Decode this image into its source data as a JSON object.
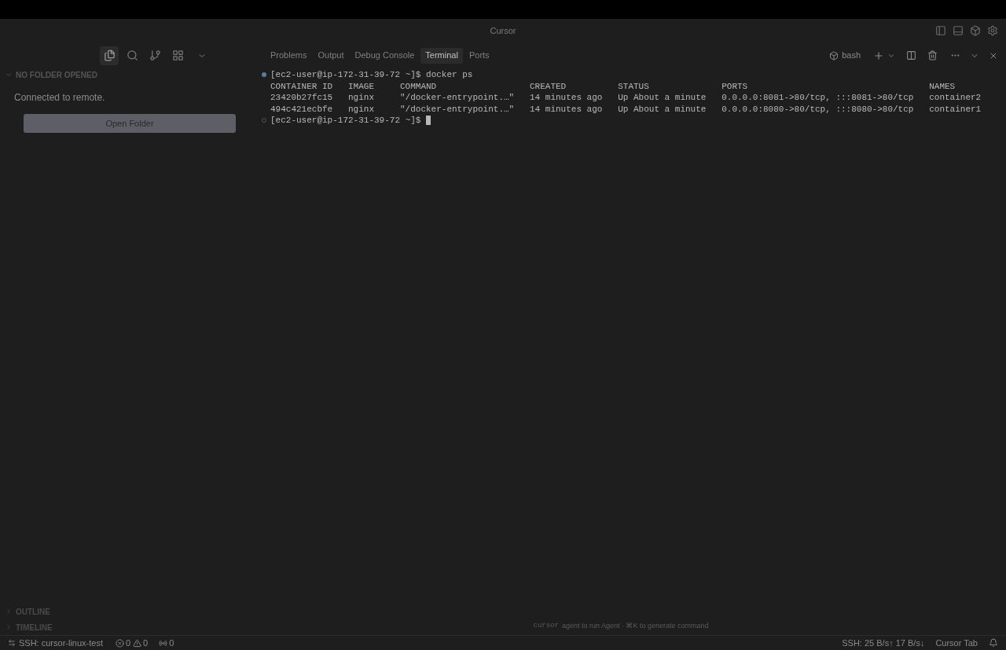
{
  "window": {
    "title": "Cursor"
  },
  "activity_tabs": [
    {
      "kind": "files",
      "selected": true
    },
    {
      "kind": "search",
      "selected": false
    },
    {
      "kind": "source-control",
      "selected": false
    },
    {
      "kind": "extensions",
      "selected": false
    }
  ],
  "sidebar": {
    "section": "NO FOLDER OPENED",
    "expanded": true,
    "message": "Connected to remote.",
    "button": "Open Folder",
    "collapsed_sections": [
      {
        "label": "OUTLINE",
        "expanded": false
      },
      {
        "label": "TIMELINE",
        "expanded": false
      }
    ]
  },
  "panel_tabs": [
    {
      "label": "Problems",
      "selected": false
    },
    {
      "label": "Output",
      "selected": false
    },
    {
      "label": "Debug Console",
      "selected": false
    },
    {
      "label": "Terminal",
      "selected": true
    },
    {
      "label": "Ports",
      "selected": false
    }
  ],
  "terminal_profile": "bash",
  "terminal": {
    "command_line": {
      "prompt": "[ec2-user@ip-172-31-39-72 ~]$",
      "command": "docker ps"
    },
    "table": {
      "columns": [
        "CONTAINER ID",
        "IMAGE",
        "COMMAND",
        "CREATED",
        "STATUS",
        "PORTS",
        "NAMES"
      ],
      "rows": [
        [
          "23420b27fc15",
          "nginx",
          "\"/docker-entrypoint.…\"",
          "14 minutes ago",
          "Up About a minute",
          "0.0.0.0:8081->80/tcp, :::8081->80/tcp",
          "container2"
        ],
        [
          "494c421ecbfe",
          "nginx",
          "\"/docker-entrypoint.…\"",
          "14 minutes ago",
          "Up About a minute",
          "0.0.0.0:8080->80/tcp, :::8080->80/tcp",
          "container1"
        ]
      ]
    },
    "current_prompt": "[ec2-user@ip-172-31-39-72 ~]$"
  },
  "hint": {
    "command": "cursor",
    "text": "agent to run Agent · ⌘K to generate command"
  },
  "status_bar": {
    "remote": "SSH: cursor-linux-test",
    "errors": "0",
    "warnings": "0",
    "ports": "0",
    "traffic": "SSH: 25 B/s↑ 17 B/s↓",
    "cursor_tab": "Cursor Tab"
  }
}
